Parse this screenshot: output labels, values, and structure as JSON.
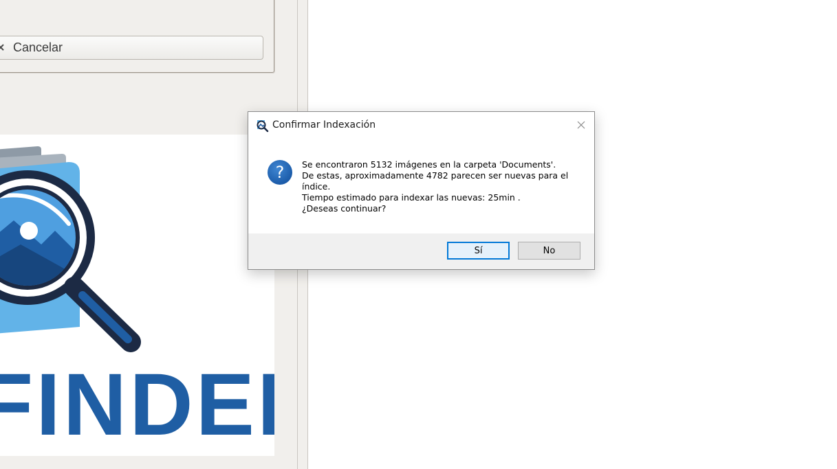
{
  "background_app": {
    "cancel_label": "Cancelar",
    "logo_text": "FINDER",
    "colors": {
      "panel": "#f1efec",
      "logo_blue": "#1f5ea4",
      "logo_light": "#62b3e8",
      "logo_dark": "#1c2a44"
    }
  },
  "dialog": {
    "title": "Confirmar Indexación",
    "app_icon": "image-search-icon",
    "close_icon": "close-icon",
    "message_icon": "question-icon",
    "message_lines": [
      "Se encontraron 5132 imágenes en la carpeta 'Documents'.",
      "De estas, aproximadamente 4782 parecen ser nuevas para el",
      "índice.",
      "Tiempo estimado para indexar las nuevas: 25min .",
      "¿Deseas continuar?"
    ],
    "yes_label": "Sí",
    "no_label": "No",
    "colors": {
      "accent": "#0078d7",
      "question_icon": "#1c64b4",
      "footer": "#f0f0f0"
    }
  }
}
